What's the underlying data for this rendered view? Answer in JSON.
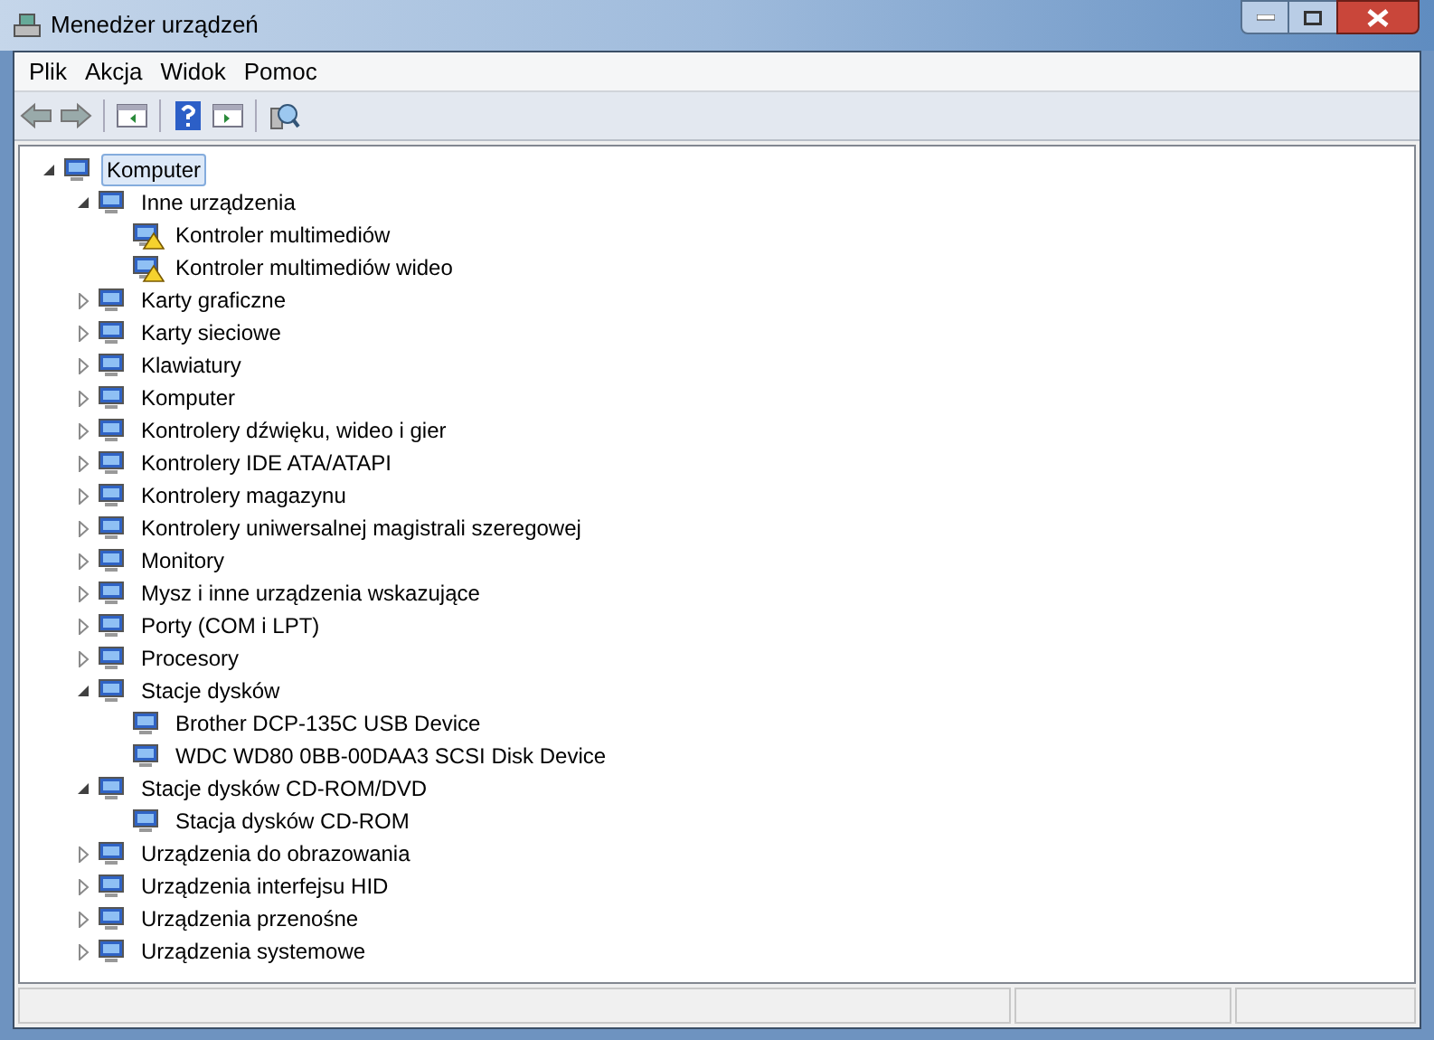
{
  "window": {
    "title": "Menedżer urządzeń"
  },
  "menu": [
    "Plik",
    "Akcja",
    "Widok",
    "Pomoc"
  ],
  "tree": [
    {
      "label": "Komputer",
      "expanded": true,
      "selected": true,
      "children": [
        {
          "label": "Inne urządzenia",
          "expanded": true,
          "selected": false,
          "children": [
            {
              "label": "Kontroler multimediów",
              "selected": false,
              "warning": true
            },
            {
              "label": "Kontroler multimediów wideo",
              "selected": false,
              "warning": true
            }
          ]
        },
        {
          "label": "Karty graficzne",
          "expanded": false,
          "selected": false
        },
        {
          "label": "Karty sieciowe",
          "expanded": false,
          "selected": false
        },
        {
          "label": "Klawiatury",
          "expanded": false,
          "selected": false
        },
        {
          "label": "Komputer",
          "expanded": false,
          "selected": false
        },
        {
          "label": "Kontrolery dźwięku, wideo i gier",
          "expanded": false,
          "selected": false
        },
        {
          "label": "Kontrolery IDE ATA/ATAPI",
          "expanded": false,
          "selected": false
        },
        {
          "label": "Kontrolery magazynu",
          "expanded": false,
          "selected": false
        },
        {
          "label": "Kontrolery uniwersalnej magistrali szeregowej",
          "expanded": false,
          "selected": false
        },
        {
          "label": "Monitory",
          "expanded": false,
          "selected": false
        },
        {
          "label": "Mysz i inne urządzenia wskazujące",
          "expanded": false,
          "selected": false
        },
        {
          "label": "Porty (COM i LPT)",
          "expanded": false,
          "selected": false
        },
        {
          "label": "Procesory",
          "expanded": false,
          "selected": false
        },
        {
          "label": "Stacje dysków",
          "expanded": true,
          "selected": false,
          "children": [
            {
              "label": "Brother DCP-135C USB Device",
              "selected": false,
              "warning": false
            },
            {
              "label": "WDC WD80 0BB-00DAA3 SCSI Disk Device",
              "selected": false,
              "warning": false
            }
          ]
        },
        {
          "label": "Stacje dysków CD-ROM/DVD",
          "expanded": true,
          "selected": false,
          "children": [
            {
              "label": "Stacja dysków CD-ROM",
              "selected": false,
              "warning": false
            }
          ]
        },
        {
          "label": "Urządzenia do obrazowania",
          "expanded": false,
          "selected": false
        },
        {
          "label": "Urządzenia interfejsu HID",
          "expanded": false,
          "selected": false
        },
        {
          "label": "Urządzenia przenośne",
          "expanded": false,
          "selected": false
        },
        {
          "label": "Urządzenia systemowe",
          "expanded": false,
          "selected": false
        }
      ]
    }
  ]
}
